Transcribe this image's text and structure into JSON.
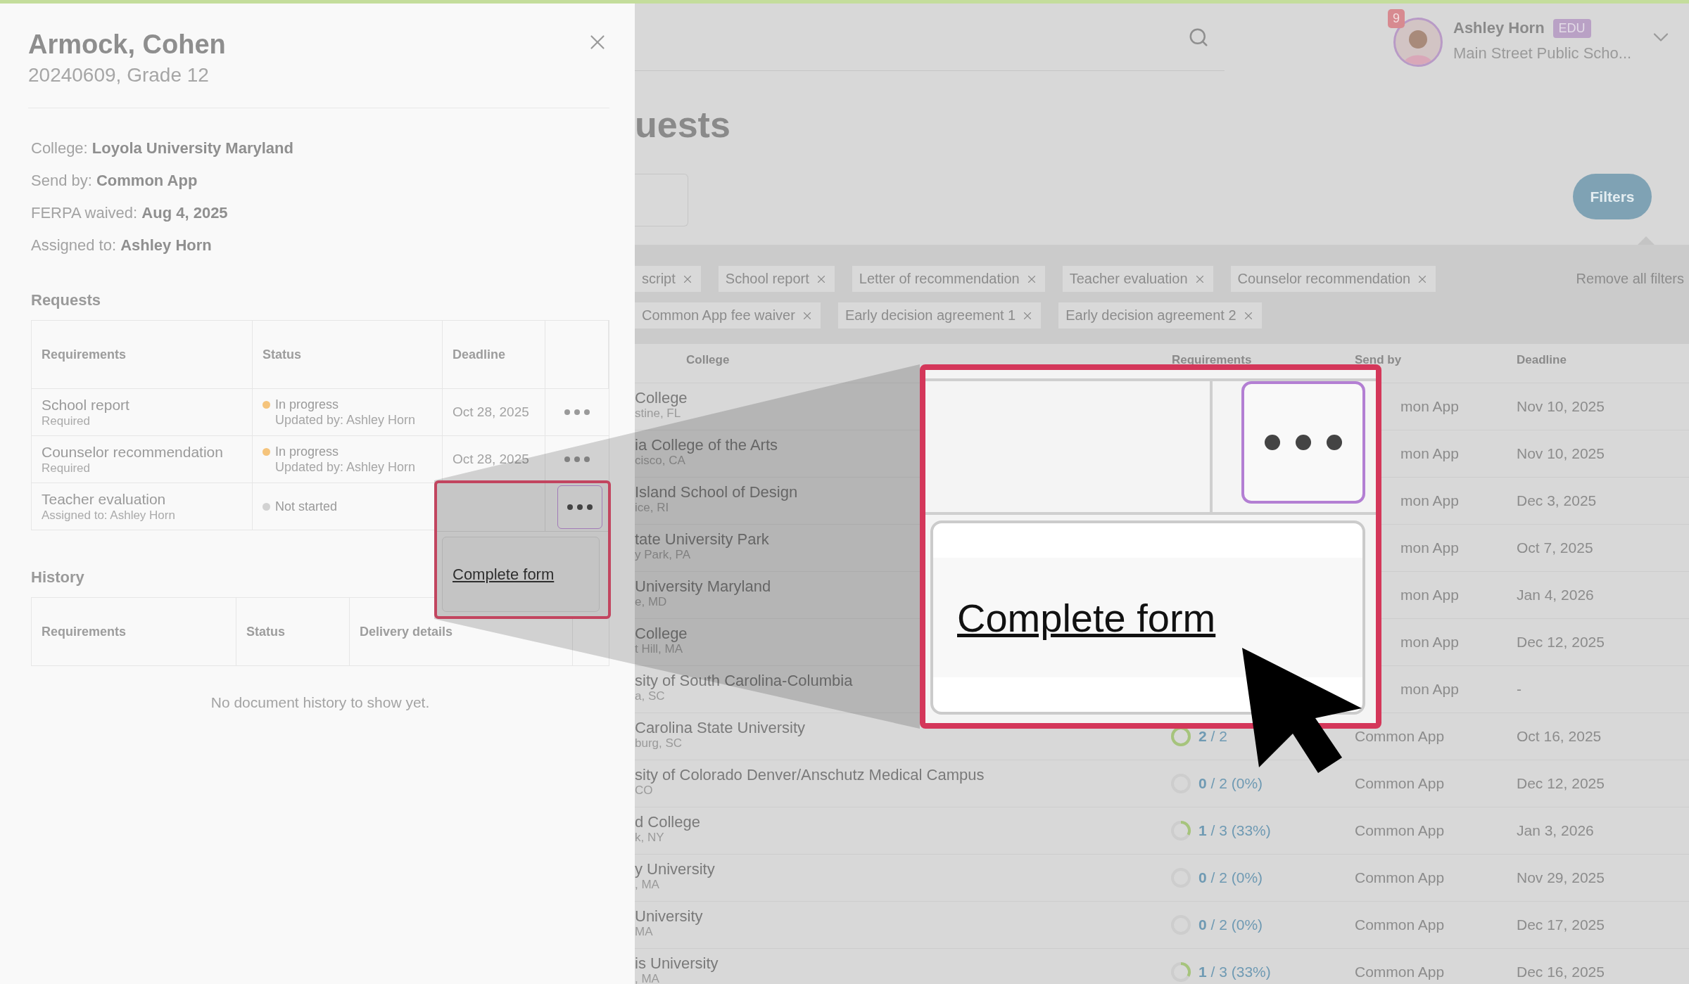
{
  "detail_panel": {
    "name": "Armock, Cohen",
    "subtitle": "20240609, Grade 12",
    "info": [
      "College: **Loyola University Maryland**",
      "Send by: **Common App**",
      "FERPA waived: **Aug 4, 2025**",
      "Assigned to: **Ashley Horn**"
    ],
    "requests": {
      "title": "Requests",
      "columns": [
        "Requirements",
        "Status",
        "Deadline"
      ],
      "rows": [
        {
          "requirement": "School report",
          "note": "Required",
          "status": "In progress",
          "color": "#f5c47c",
          "updated": "Updated by: Ashley Horn",
          "deadline": "Oct 28, 2025"
        },
        {
          "requirement": "Counselor recommendation",
          "note": "Required",
          "status": "In progress",
          "color": "#f5c47c",
          "updated": "Updated by: Ashley Horn",
          "deadline": "Oct 28, 2025"
        },
        {
          "requirement": "Teacher evaluation",
          "note": "Assigned to: Ashley Horn",
          "status": "Not started",
          "color": "#d2d2d2"
        }
      ]
    },
    "history": {
      "title": "History",
      "columns": [
        "Requirements",
        "Status",
        "Delivery details"
      ],
      "empty_message": "No document history to show yet."
    }
  },
  "callouts": {
    "highlight": {
      "menu_item": "Complete form"
    },
    "magnified": {
      "menu_item": "Complete form"
    }
  },
  "page": {
    "user": {
      "notifications": "9",
      "name": "Ashley Horn",
      "badge": "EDU",
      "school": "Main Street Public Scho..."
    },
    "title": "uests",
    "filters_button": "Filters",
    "filter_rows": [
      {
        "chips": [
          "script",
          "School report",
          "Letter of recommendation",
          "Teacher evaluation",
          "Counselor recommendation"
        ]
      },
      {
        "chips": [
          "Common App fee waiver",
          "Early decision agreement 1",
          "Early decision agreement 2"
        ]
      }
    ],
    "remove_filters": "Remove all filters",
    "table": {
      "columns": [
        "College",
        "Requirements",
        "Send by",
        "Deadline"
      ],
      "rows": [
        {
          "college": "College",
          "location": "stine, FL",
          "send_by": "mon App",
          "clipped": true,
          "deadline": "Nov 10, 2025"
        },
        {
          "college": "ia College of the Arts",
          "location": "cisco, CA",
          "send_by": "mon App",
          "clipped": true,
          "deadline": "Nov 10, 2025"
        },
        {
          "college": "Island School of Design",
          "location": "ice, RI",
          "send_by": "mon App",
          "clipped": true,
          "deadline": "Dec 3, 2025"
        },
        {
          "college": "tate University Park",
          "location": "y Park, PA",
          "send_by": "mon App",
          "clipped": true,
          "deadline": "Oct 7, 2025"
        },
        {
          "college": "University Maryland",
          "location": "e, MD",
          "send_by": "mon App",
          "clipped": true,
          "deadline": "Jan 4, 2026"
        },
        {
          "college": "College",
          "location": "t Hill, MA",
          "send_by": "mon App",
          "clipped": true,
          "deadline": "Dec 12, 2025"
        },
        {
          "college": "sity of South Carolina-Columbia",
          "location": "a, SC",
          "send_by": "mon App",
          "clipped": true,
          "deadline": "-"
        },
        {
          "college": "Carolina State University",
          "location": "burg, SC",
          "progress": "**2** / 2",
          "level": 1,
          "send_by": "Common App",
          "clipped": false,
          "deadline": "Oct 16, 2025"
        },
        {
          "college": "sity of Colorado Denver/Anschutz Medical Campus",
          "location": "CO",
          "progress": "**0** / 2 (0%)",
          "send_by": "Common App",
          "clipped": false,
          "deadline": "Dec 12, 2025"
        },
        {
          "college": "d College",
          "location": "k, NY",
          "progress": "**1** / 3 (33%)",
          "level": 0.33,
          "send_by": "Common App",
          "clipped": false,
          "deadline": "Jan 3, 2026"
        },
        {
          "college": "y University",
          "location": ", MA",
          "progress": "**0** / 2 (0%)",
          "send_by": "Common App",
          "clipped": false,
          "deadline": "Nov 29, 2025"
        },
        {
          "college": "University",
          "location": "MA",
          "progress": "**0** / 2 (0%)",
          "send_by": "Common App",
          "clipped": false,
          "deadline": "Dec 17, 2025"
        },
        {
          "college": "is University",
          "location": ", MA",
          "progress": "**1** / 3 (33%)",
          "level": 0.33,
          "send_by": "Common App",
          "clipped": false,
          "deadline": "Dec 16, 2025"
        }
      ]
    }
  }
}
